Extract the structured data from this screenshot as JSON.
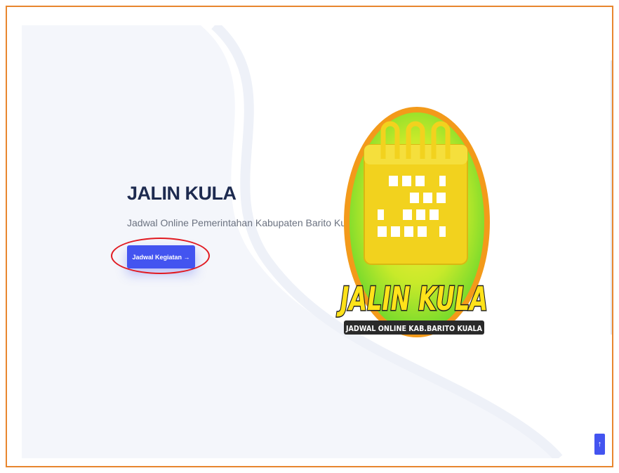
{
  "hero": {
    "title": "JALIN KULA",
    "subtitle": "Jadwal Online Pemerintahan Kabupaten Barito Kuala",
    "cta_label": "Jadwal Kegiatan →"
  },
  "logo": {
    "main_text": "JALIN KULA",
    "tagline": "JADWAL ONLINE KAB.BARITO KUALA"
  },
  "back_to_top": {
    "icon": "↑"
  },
  "colors": {
    "accent": "#4354f0",
    "highlight_ring": "#e11b22",
    "frame_border": "#e8862e",
    "title": "#1d2a4f"
  }
}
